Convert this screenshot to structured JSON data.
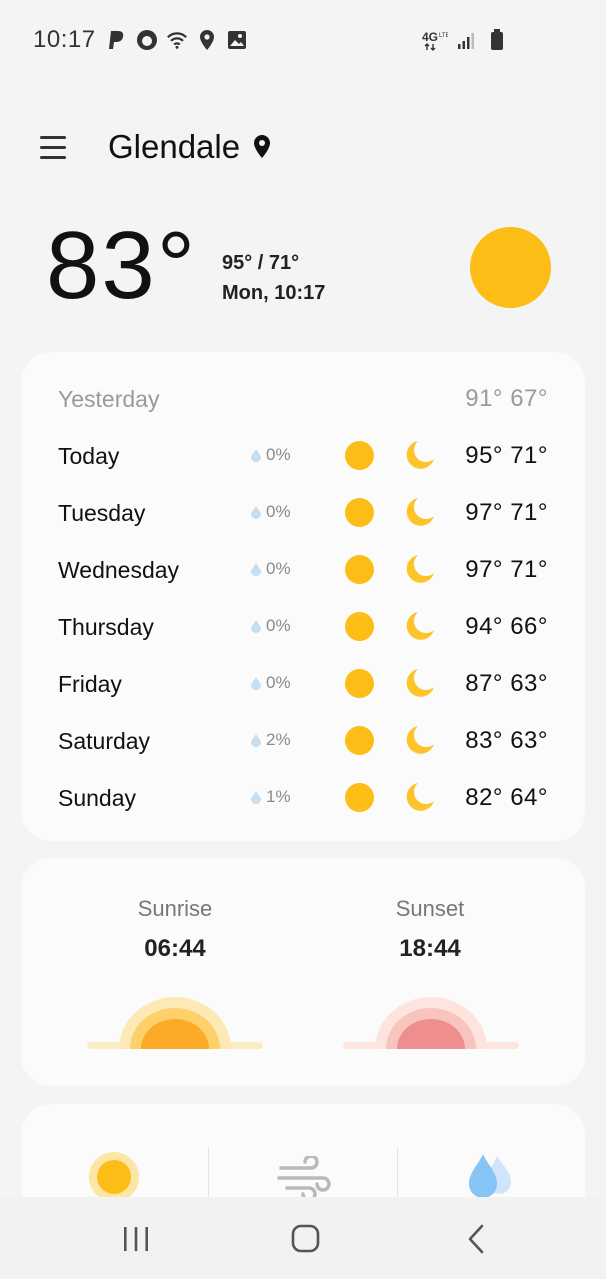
{
  "status_bar": {
    "time": "10:17",
    "left_icons": [
      "paypal-icon",
      "circle-app-icon",
      "wifi-icon",
      "location-icon",
      "image-icon"
    ],
    "right_icons": [
      "4g-lte-icon",
      "signal-icon",
      "battery-icon"
    ]
  },
  "header": {
    "city": "Glendale"
  },
  "current": {
    "temperature": "83°",
    "high_low": "95° / 71°",
    "day_time": "Mon, 10:17"
  },
  "forecast": {
    "yesterday": {
      "label": "Yesterday",
      "temps": "91° 67°"
    },
    "days": [
      {
        "label": "Today",
        "precip": "0%",
        "temps": "95° 71°"
      },
      {
        "label": "Tuesday",
        "precip": "0%",
        "temps": "97° 71°"
      },
      {
        "label": "Wednesday",
        "precip": "0%",
        "temps": "97° 71°"
      },
      {
        "label": "Thursday",
        "precip": "0%",
        "temps": "94° 66°"
      },
      {
        "label": "Friday",
        "precip": "0%",
        "temps": "87° 63°"
      },
      {
        "label": "Saturday",
        "precip": "2%",
        "temps": "83° 63°"
      },
      {
        "label": "Sunday",
        "precip": "1%",
        "temps": "82° 64°"
      }
    ]
  },
  "sun": {
    "sunrise_label": "Sunrise",
    "sunrise_time": "06:44",
    "sunset_label": "Sunset",
    "sunset_time": "18:44"
  },
  "bottom_card": {
    "icons": [
      "uv-sun-icon",
      "wind-icon",
      "humidity-drops-icon"
    ]
  },
  "colors": {
    "sun": "#fdbd17",
    "moon": "#fdc42a",
    "sunset": "#ee8e8e",
    "card_bg": "#fbfbfb",
    "page_bg": "#f4f4f4"
  }
}
